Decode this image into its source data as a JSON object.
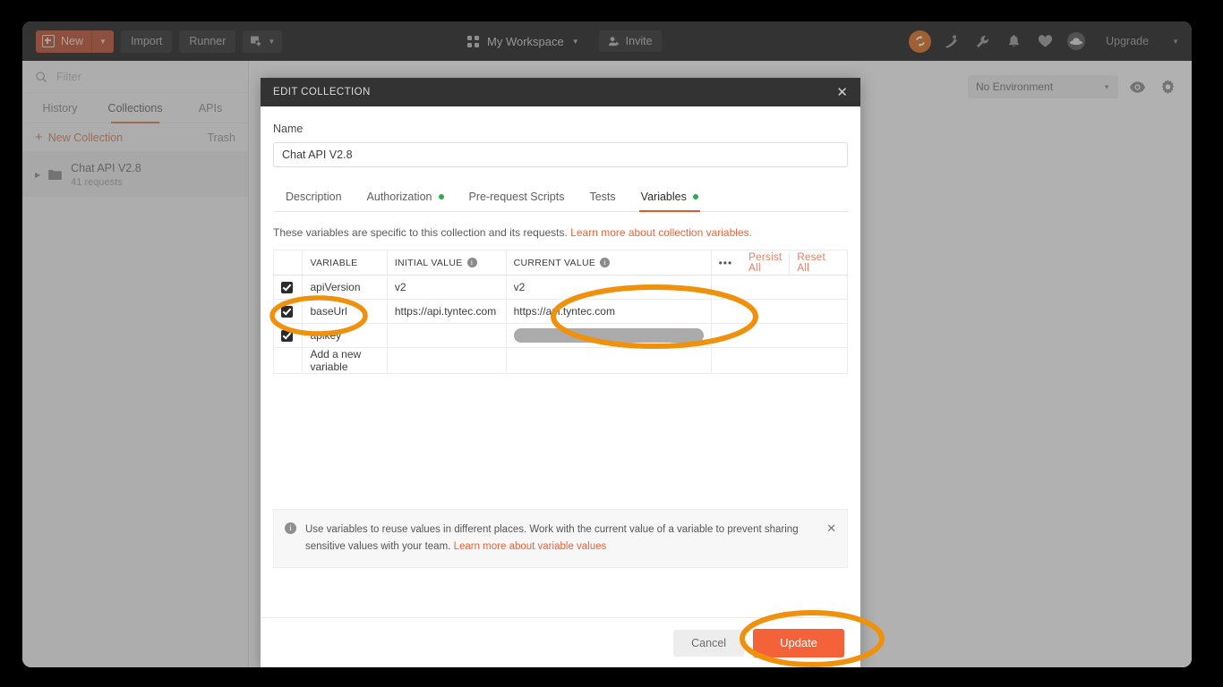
{
  "toolbar": {
    "new_label": "New",
    "import_label": "Import",
    "runner_label": "Runner",
    "workspace_label": "My Workspace",
    "invite_label": "Invite",
    "upgrade_label": "Upgrade",
    "icons": [
      "sync-icon",
      "satellite-icon",
      "wrench-icon",
      "bell-icon",
      "heart-icon",
      "ufo-icon"
    ]
  },
  "sidebar": {
    "filter_placeholder": "Filter",
    "tabs": [
      {
        "label": "History",
        "active": false
      },
      {
        "label": "Collections",
        "active": true
      },
      {
        "label": "APIs",
        "active": false
      }
    ],
    "new_collection_label": "New Collection",
    "trash_label": "Trash",
    "collection": {
      "name": "Chat API V2.8",
      "count": "41 requests"
    }
  },
  "environment": {
    "selected": "No Environment",
    "eye_icon": "eye-icon",
    "settings_icon": "gear-icon"
  },
  "modal": {
    "title": "EDIT COLLECTION",
    "close_icon": "close-icon",
    "name_label": "Name",
    "name_value": "Chat API V2.8",
    "tabs": [
      {
        "label": "Description",
        "active": false,
        "dot": false
      },
      {
        "label": "Authorization",
        "active": false,
        "dot": true
      },
      {
        "label": "Pre-request Scripts",
        "active": false,
        "dot": false
      },
      {
        "label": "Tests",
        "active": false,
        "dot": false
      },
      {
        "label": "Variables",
        "active": true,
        "dot": true
      }
    ],
    "description_text": "These variables are specific to this collection and its requests.",
    "description_link": "Learn more about collection variables.",
    "table": {
      "headers": [
        "VARIABLE",
        "INITIAL VALUE",
        "CURRENT VALUE"
      ],
      "dots_label": "•••",
      "persist_all_label": "Persist All",
      "reset_all_label": "Reset All",
      "rows": [
        {
          "checked": true,
          "variable": "apiVersion",
          "initial": "v2",
          "current": "v2",
          "redacted": false
        },
        {
          "checked": true,
          "variable": "baseUrl",
          "initial": "https://api.tyntec.com",
          "current": "https://api.tyntec.com",
          "redacted": false
        },
        {
          "checked": true,
          "variable": "apikey",
          "initial": "",
          "current": "",
          "redacted": true
        }
      ],
      "add_row_placeholder": "Add a new variable"
    },
    "banner": {
      "text": "Use variables to reuse values in different places. Work with the current value of a variable to prevent sharing sensitive values with your team.",
      "link": "Learn more about variable values",
      "close_icon": "close-icon"
    },
    "cancel_label": "Cancel",
    "update_label": "Update"
  },
  "annotations": {
    "color": "#F0910D",
    "highlights": [
      "apikey-row-variable",
      "apikey-current-value",
      "update-button"
    ]
  }
}
